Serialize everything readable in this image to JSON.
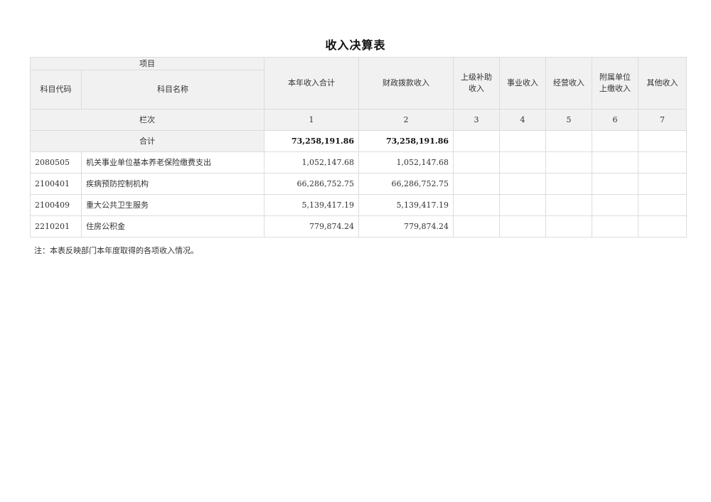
{
  "title": "收入决算表",
  "header": {
    "item": "项目",
    "code": "科目代码",
    "name": "科目名称",
    "total_income": "本年收入合计",
    "fiscal": "财政拨款收入",
    "superior_l1": "上级补助",
    "superior_l2": "收入",
    "business": "事业收入",
    "operating": "经营收入",
    "affiliated_l1": "附属单位",
    "affiliated_l2": "上缴收入",
    "other": "其他收入"
  },
  "column_row": {
    "label": "栏次",
    "numbers": [
      "1",
      "2",
      "3",
      "4",
      "5",
      "6",
      "7"
    ]
  },
  "total_row": {
    "label": "合计",
    "total_income": "73,258,191.86",
    "fiscal": "73,258,191.86"
  },
  "rows": [
    {
      "code": "2080505",
      "name": "机关事业单位基本养老保险缴费支出",
      "total_income": "1,052,147.68",
      "fiscal": "1,052,147.68"
    },
    {
      "code": "2100401",
      "name": "疾病预防控制机构",
      "total_income": "66,286,752.75",
      "fiscal": "66,286,752.75"
    },
    {
      "code": "2100409",
      "name": "重大公共卫生服务",
      "total_income": "5,139,417.19",
      "fiscal": "5,139,417.19"
    },
    {
      "code": "2210201",
      "name": "住房公积金",
      "total_income": "779,874.24",
      "fiscal": "779,874.24"
    }
  ],
  "note": "注：本表反映部门本年度取得的各项收入情况。"
}
